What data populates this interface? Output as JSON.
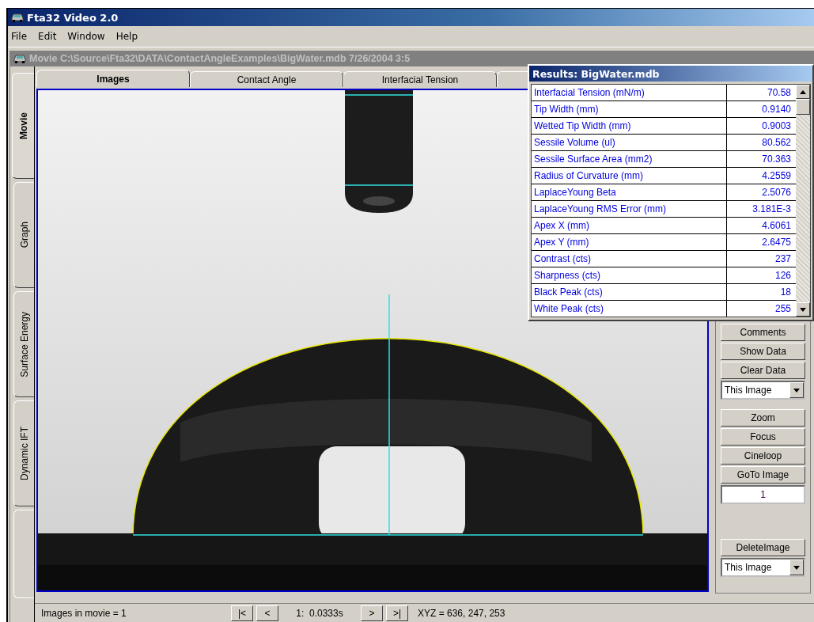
{
  "window": {
    "title": "Fta32 Video 2.0"
  },
  "menu": [
    "File",
    "Edit",
    "Window",
    "Help"
  ],
  "document": {
    "title": "Movie C:\\Source\\Fta32\\DATA\\ContactAngleExamples\\BigWater.mdb 7/26/2004 3:5"
  },
  "side_tabs": [
    {
      "label": "Movie",
      "selected": true
    },
    {
      "label": "Graph",
      "selected": false
    },
    {
      "label": "Surface Energy",
      "selected": false
    },
    {
      "label": "Dynamic IFT",
      "selected": false
    }
  ],
  "tabs": [
    {
      "label": "Images",
      "selected": true
    },
    {
      "label": "Contact Angle",
      "selected": false
    },
    {
      "label": "Interfacial Tension",
      "selected": false
    }
  ],
  "controls": [
    {
      "kind": "button",
      "label": "Comments"
    },
    {
      "kind": "button",
      "label": "Show Data"
    },
    {
      "kind": "button",
      "label": "Clear Data"
    },
    {
      "kind": "dropdown",
      "value": "This Image"
    },
    {
      "kind": "spacer"
    },
    {
      "kind": "button",
      "label": "Zoom"
    },
    {
      "kind": "button",
      "label": "Focus"
    },
    {
      "kind": "button",
      "label": "Cineloop"
    },
    {
      "kind": "button",
      "label": "GoTo Image"
    },
    {
      "kind": "input",
      "value": "1"
    },
    {
      "kind": "bigspacer"
    },
    {
      "kind": "button",
      "label": "DeleteImage"
    },
    {
      "kind": "dropdown",
      "value": "This Image"
    }
  ],
  "status_bar": {
    "images": "Images in movie = 1",
    "nav_back": [
      "|<",
      "<"
    ],
    "frame": "1:  0.0333s",
    "nav_forward": [
      ">",
      ">|"
    ],
    "xyz": "XYZ = 636, 247, 253"
  },
  "results": {
    "title": "Results: BigWater.mdb",
    "rows": [
      {
        "name": "Interfacial Tension (mN/m)",
        "value": "70.58"
      },
      {
        "name": "Tip Width (mm)",
        "value": "0.9140"
      },
      {
        "name": "Wetted Tip Width (mm)",
        "value": "0.9003"
      },
      {
        "name": "Sessile Volume (ul)",
        "value": "80.562"
      },
      {
        "name": "Sessile Surface Area (mm2)",
        "value": "70.363"
      },
      {
        "name": "Radius of Curvature (mm)",
        "value": "4.2559"
      },
      {
        "name": "LaplaceYoung Beta",
        "value": "2.5076"
      },
      {
        "name": "LaplaceYoung RMS Error (mm)",
        "value": "3.181E-3"
      },
      {
        "name": "Apex X (mm)",
        "value": "4.6061"
      },
      {
        "name": "Apex Y (mm)",
        "value": "2.6475"
      },
      {
        "name": "Contrast (cts)",
        "value": "237"
      },
      {
        "name": "Sharpness (cts)",
        "value": "126"
      },
      {
        "name": "Black Peak (cts)",
        "value": "18"
      },
      {
        "name": "White Peak (cts)",
        "value": "255"
      }
    ]
  }
}
